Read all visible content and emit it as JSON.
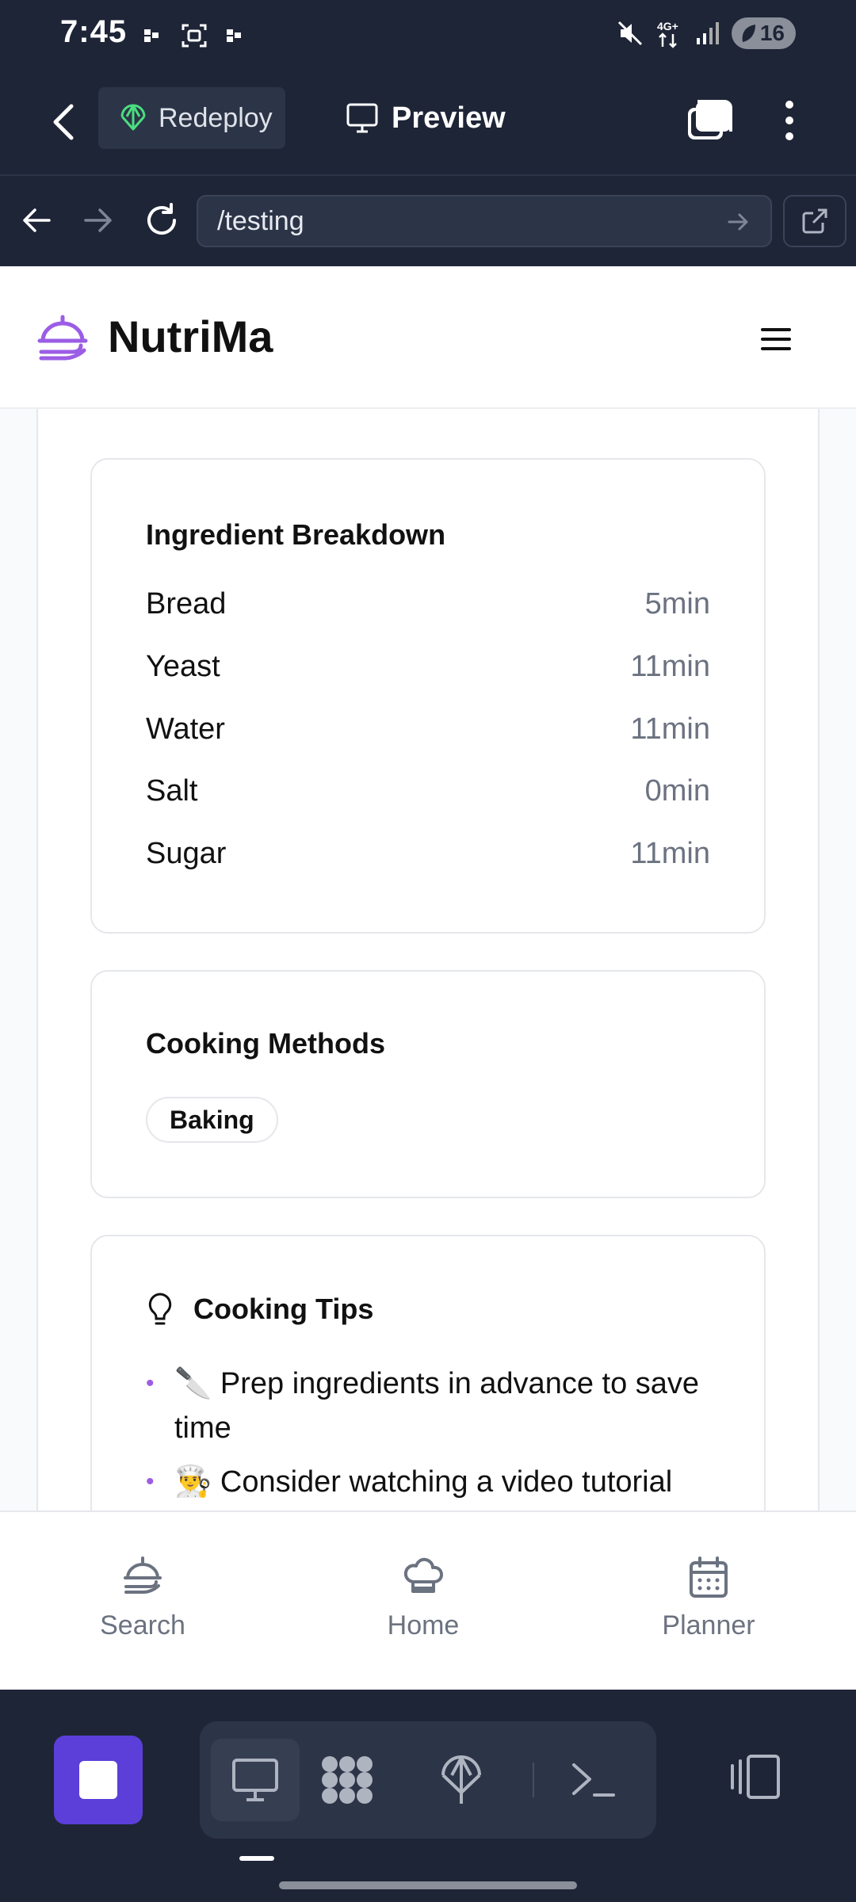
{
  "status_bar": {
    "time": "7:45",
    "battery": "16",
    "icons": [
      "notification-icon",
      "screenshot-icon",
      "notification-icon",
      "mute-icon",
      "4g-icon",
      "signal-icon",
      "battery-icon"
    ]
  },
  "app_header": {
    "redeploy_label": "Redeploy",
    "preview_label": "Preview"
  },
  "url_bar": {
    "url": "/testing"
  },
  "site": {
    "title": "NutriMa"
  },
  "ingredients": {
    "title": "Ingredient Breakdown",
    "items": [
      {
        "name": "Bread",
        "time": "5min"
      },
      {
        "name": "Yeast",
        "time": "11min"
      },
      {
        "name": "Water",
        "time": "11min"
      },
      {
        "name": "Salt",
        "time": "0min"
      },
      {
        "name": "Sugar",
        "time": "11min"
      }
    ]
  },
  "methods": {
    "title": "Cooking Methods",
    "items": [
      "Baking"
    ]
  },
  "tips": {
    "title": "Cooking Tips",
    "items": [
      "🔪 Prep ingredients in advance to save time",
      "👨‍🍳 Consider watching a video tutorial"
    ]
  },
  "bottom_nav": {
    "items": [
      {
        "label": "Search",
        "icon": "dish-icon"
      },
      {
        "label": "Home",
        "icon": "chef-hat-icon"
      },
      {
        "label": "Planner",
        "icon": "calendar-icon"
      }
    ]
  },
  "colors": {
    "accent": "#9b5de5",
    "ide_background": "#1e2537",
    "run_button": "#5b3fd8"
  }
}
